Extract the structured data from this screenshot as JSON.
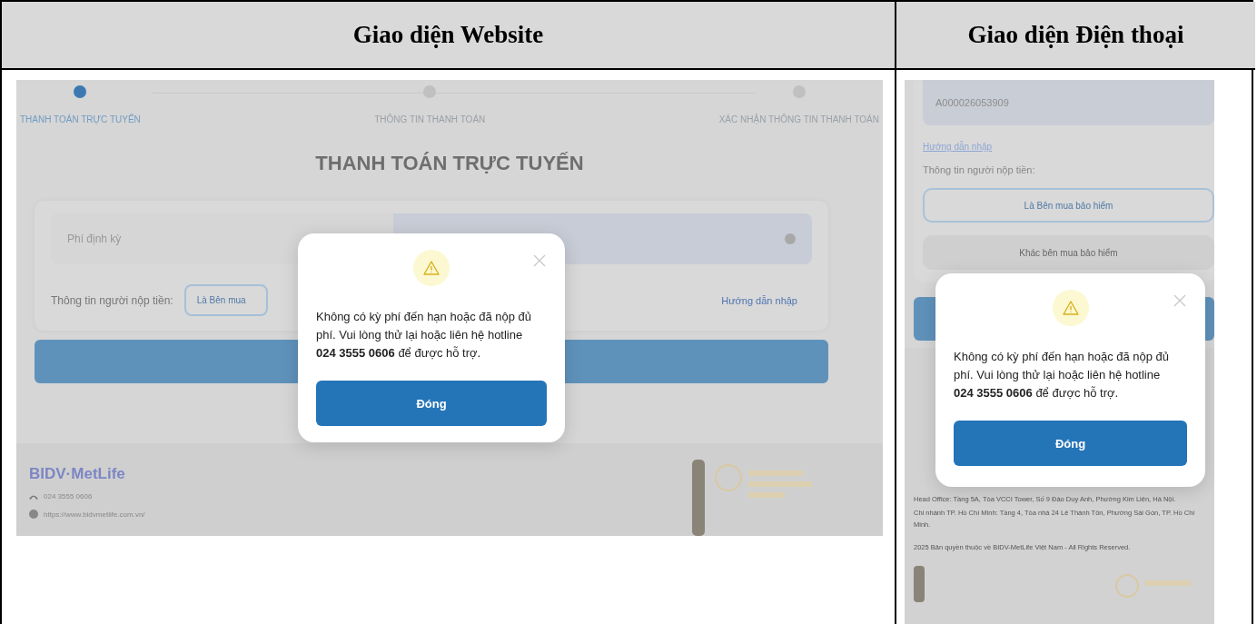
{
  "table": {
    "columns": [
      "Giao diện Website",
      "Giao diện Điện thoại"
    ]
  },
  "website": {
    "steps": [
      {
        "label": "THANH TOÁN TRỰC TUYẾN",
        "selected": true
      },
      {
        "label": "THÔNG TIN THANH TOÁN",
        "selected": false
      },
      {
        "label": "XÁC NHẬN THÔNG TIN THANH TOÁN",
        "selected": false
      }
    ],
    "title": "THANH TOÁN TRỰC TUYẾN",
    "fee_field": {
      "placeholder": "Phí định kỳ"
    },
    "payer_label": "Thông tin người nộp tiền:",
    "payer_option": "Là Bên mua",
    "guide_link": "Hướng dẫn nhập",
    "footer": {
      "logo": "BIDV·MetLife",
      "phone": "024 3555 0606",
      "website": "https://www.bidvmetlife.com.vn/"
    },
    "dialog": {
      "message": "Không có kỳ phí đến hạn hoặc đã nộp đủ phí. Vui lòng thử lại hoặc liên hệ hotline **024 3555 0606** để được hỗ trợ.",
      "button": "Đóng"
    }
  },
  "phone": {
    "policy_number": "A000026053909",
    "guide_link": "Hướng dẫn nhập",
    "payer_label": "Thông tin người nộp tiền:",
    "payer_options": [
      {
        "label": "Là Bên mua bảo hiểm",
        "selected": true
      },
      {
        "label": "Khác bên mua bảo hiểm",
        "selected": false
      }
    ],
    "footer": {
      "address": [
        "Head Office: Tầng 5A, Tòa VCCI Tower, Số 9 Đào Duy Anh, Phường Kim Liên, Hà Nội.",
        "Chi nhánh TP. Hồ Chí Minh: Tầng 4, Tòa nhà 24 Lê Thánh Tôn, Phường Sài Gòn, TP. Hồ Chí Minh."
      ],
      "copyright": "2025 Bản quyền thuộc về BIDV-MetLife Việt Nam - All Rights Reserved."
    },
    "dialog": {
      "message": "Không có kỳ phí đến hạn hoặc đã nộp đủ phí. Vui lòng thử lại hoặc liên hệ hotline **024 3555 0606** để được hỗ trợ.",
      "button": "Đóng"
    }
  }
}
